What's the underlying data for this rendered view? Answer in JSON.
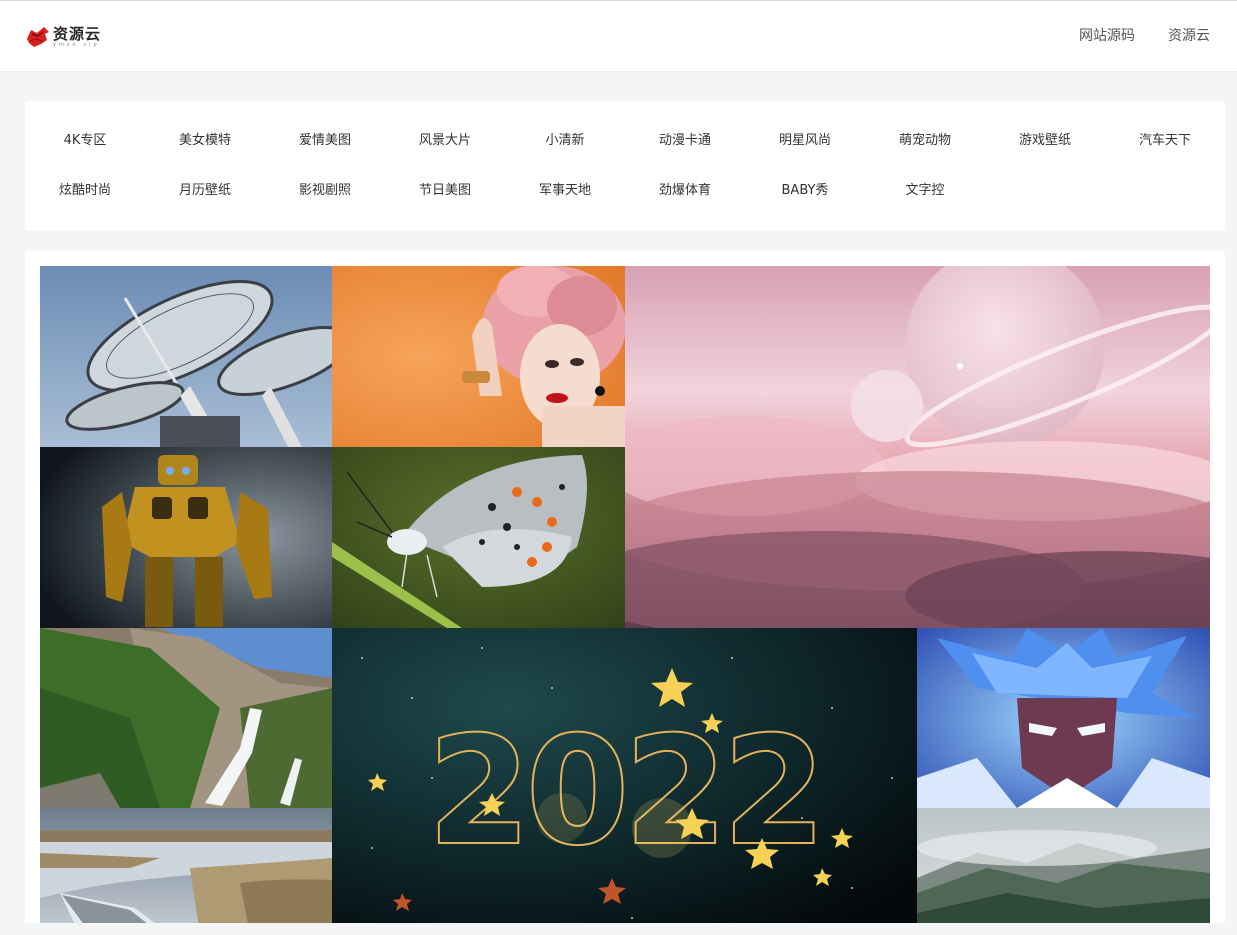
{
  "header": {
    "logo": {
      "title": "资源云",
      "subtitle": "ymsn vip"
    },
    "nav": [
      "网站源码",
      "资源云"
    ]
  },
  "categories": [
    "4K专区",
    "美女模特",
    "爱情美图",
    "风景大片",
    "小清新",
    "动漫卡通",
    "明星风尚",
    "萌宠动物",
    "游戏壁纸",
    "汽车天下",
    "炫酷时尚",
    "月历壁纸",
    "影视剧照",
    "节日美图",
    "军事天地",
    "劲爆体育",
    "BABY秀",
    "文字控"
  ],
  "colors": {
    "page_background": "#f4f5f7",
    "card_background": "#ffffff",
    "logo_red": "#d81e1e"
  },
  "gallery": {
    "tiles": [
      {
        "name": "satellite-dishes-thumbnail",
        "subject": "satellite dishes"
      },
      {
        "name": "pink-hair-woman-thumbnail",
        "subject": "pink-haired woman on orange background"
      },
      {
        "name": "pink-clouds-planets-thumbnail",
        "subject": "pink clouds with planets"
      },
      {
        "name": "bumblebee-robot-thumbnail",
        "subject": "yellow robot"
      },
      {
        "name": "butterfly-thumbnail",
        "subject": "butterfly on a stem"
      },
      {
        "name": "waterfall-mountain-thumbnail",
        "subject": "mountain waterfall"
      },
      {
        "name": "new-year-2022-thumbnail",
        "subject": "2022 sparkler stars"
      },
      {
        "name": "anime-hero-thumbnail",
        "subject": "anime hero with blue hair"
      },
      {
        "name": "lake-boat-thumbnail",
        "subject": "boat by a lake"
      },
      {
        "name": "misty-mountains-thumbnail",
        "subject": "misty mountains"
      }
    ],
    "new_year_text": "2022"
  }
}
